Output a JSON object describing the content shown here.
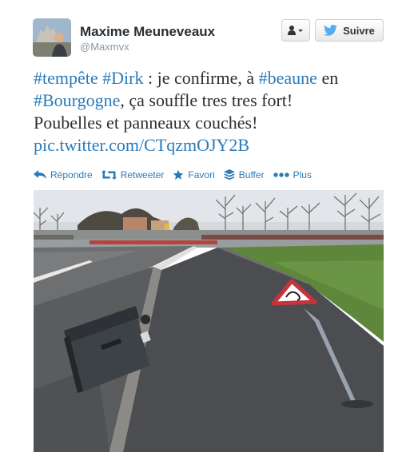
{
  "author": {
    "name": "Maxime Meuneveaux",
    "handle": "@Maxmvx"
  },
  "header": {
    "follow_label": "Suivre",
    "user_menu_icon": "user-dropdown-icon",
    "follow_icon": "twitter-bird-icon"
  },
  "tweet": {
    "l1_tag1": "#tempête",
    "l1_tag2": "#Dirk",
    "l1_text": " : je confirme, à ",
    "l1_tag3": "#beaune",
    "l1_text2": " en",
    "l2_tag": "#Bourgogne",
    "l2_text": ", ça souffle tres tres fort!",
    "l3_text": "Poubelles et panneaux couchés!",
    "l4_link": "pic.twitter.com/CTqzmOJY2B"
  },
  "actions": [
    {
      "label": "Répondre",
      "icon": "reply-icon"
    },
    {
      "label": "Retweeter",
      "icon": "retweet-icon"
    },
    {
      "label": "Favori",
      "icon": "star-icon"
    },
    {
      "label": "Buffer",
      "icon": "buffer-icon"
    },
    {
      "label": "Plus",
      "icon": "more-dots-icon"
    }
  ],
  "colors": {
    "link": "#2b7bb9",
    "name": "#292f33",
    "handle": "#8899a6"
  },
  "photo": {
    "description_icon": "attached-photo",
    "sign_icon": "warning-triangle-sign"
  }
}
